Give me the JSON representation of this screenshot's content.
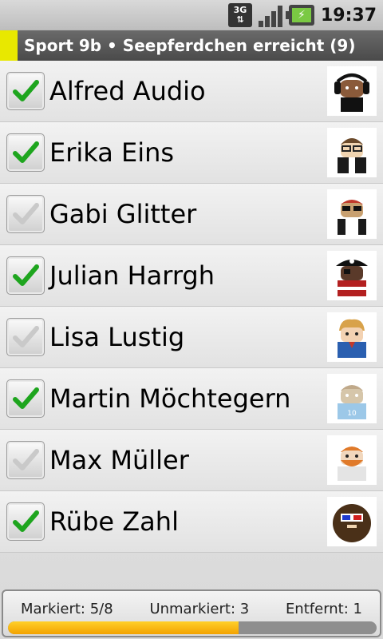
{
  "status_bar": {
    "network": "3G",
    "time": "19:37"
  },
  "title_bar": {
    "title": "Sport 9b • Seepferdchen erreicht (9)",
    "accent_color": "#e8e800"
  },
  "students": [
    {
      "name": "Alfred Audio",
      "checked": true,
      "avatar": "android-headphones-avatar"
    },
    {
      "name": "Erika Eins",
      "checked": true,
      "avatar": "android-glasses-avatar"
    },
    {
      "name": "Gabi Glitter",
      "checked": false,
      "avatar": "android-sunglasses-avatar"
    },
    {
      "name": "Julian Harrgh",
      "checked": true,
      "avatar": "android-pirate-avatar"
    },
    {
      "name": "Lisa Lustig",
      "checked": false,
      "avatar": "android-blonde-avatar"
    },
    {
      "name": "Martin Möchtegern",
      "checked": true,
      "avatar": "android-jersey-avatar"
    },
    {
      "name": "Max Müller",
      "checked": false,
      "avatar": "android-beard-avatar"
    },
    {
      "name": "Rübe Zahl",
      "checked": true,
      "avatar": "android-3d-glasses-avatar"
    }
  ],
  "footer": {
    "marked": "Markiert: 5/8",
    "unmarked": "Unmarkiert: 3",
    "removed": "Entfernt: 1",
    "progress_fraction": 0.625,
    "progress_color": "#f3a200"
  }
}
